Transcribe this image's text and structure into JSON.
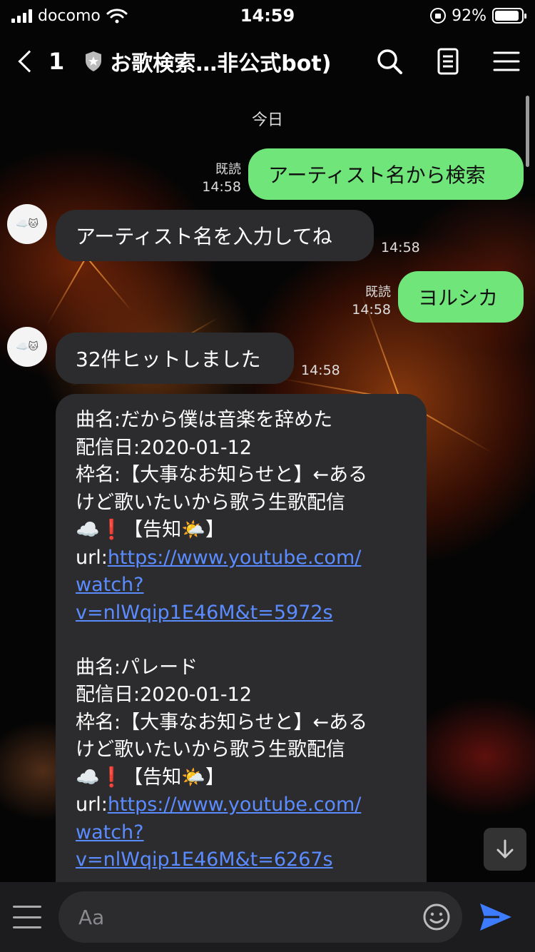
{
  "status_bar": {
    "carrier": "docomo",
    "time": "14:59",
    "battery": "92%",
    "battery_level": 0.92
  },
  "header": {
    "back_count": "1",
    "title": "お歌検索…非公式bot)"
  },
  "chat": {
    "date_label": "今日",
    "messages": [
      {
        "from": "me",
        "text": "アーティスト名から検索",
        "read": "既読",
        "time": "14:58"
      },
      {
        "from": "bot",
        "text": "アーティスト名を入力してね",
        "time": "14:58"
      },
      {
        "from": "me",
        "text": "ヨルシカ",
        "read": "既読",
        "time": "14:58"
      },
      {
        "from": "bot",
        "text": "32件ヒットしました",
        "time": "14:58"
      }
    ],
    "avatar_label": "☁️🐱",
    "results": [
      {
        "song_line": "曲名:だから僕は音楽を辞めた",
        "date_line": "配信日:2020-01-12",
        "slot_line1": "枠名:【大事なお知らせと】←ある",
        "slot_line2": "けど歌いたいから歌う生歌配信",
        "slot_line3": "☁️❗【告知🌤️】",
        "url_prefix": "url:",
        "url_line1": "https://www.youtube.com/",
        "url_line2": "watch?",
        "url_line3": "v=nlWqip1E46M&t=5972s"
      },
      {
        "song_line": "曲名:パレード",
        "date_line": "配信日:2020-01-12",
        "slot_line1": "枠名:【大事なお知らせと】←ある",
        "slot_line2": "けど歌いたいから歌う生歌配信",
        "slot_line3": "☁️❗【告知🌤️】",
        "url_prefix": "url:",
        "url_line1": "https://www.youtube.com/",
        "url_line2": "watch?",
        "url_line3": "v=nlWqip1E46M&t=6267s"
      }
    ]
  },
  "input_bar": {
    "placeholder": "Aa"
  },
  "colors": {
    "bubble_out": "#6fe57a",
    "bubble_in": "#2c2c2e",
    "link": "#5b8cff",
    "send": "#3d7bff"
  }
}
